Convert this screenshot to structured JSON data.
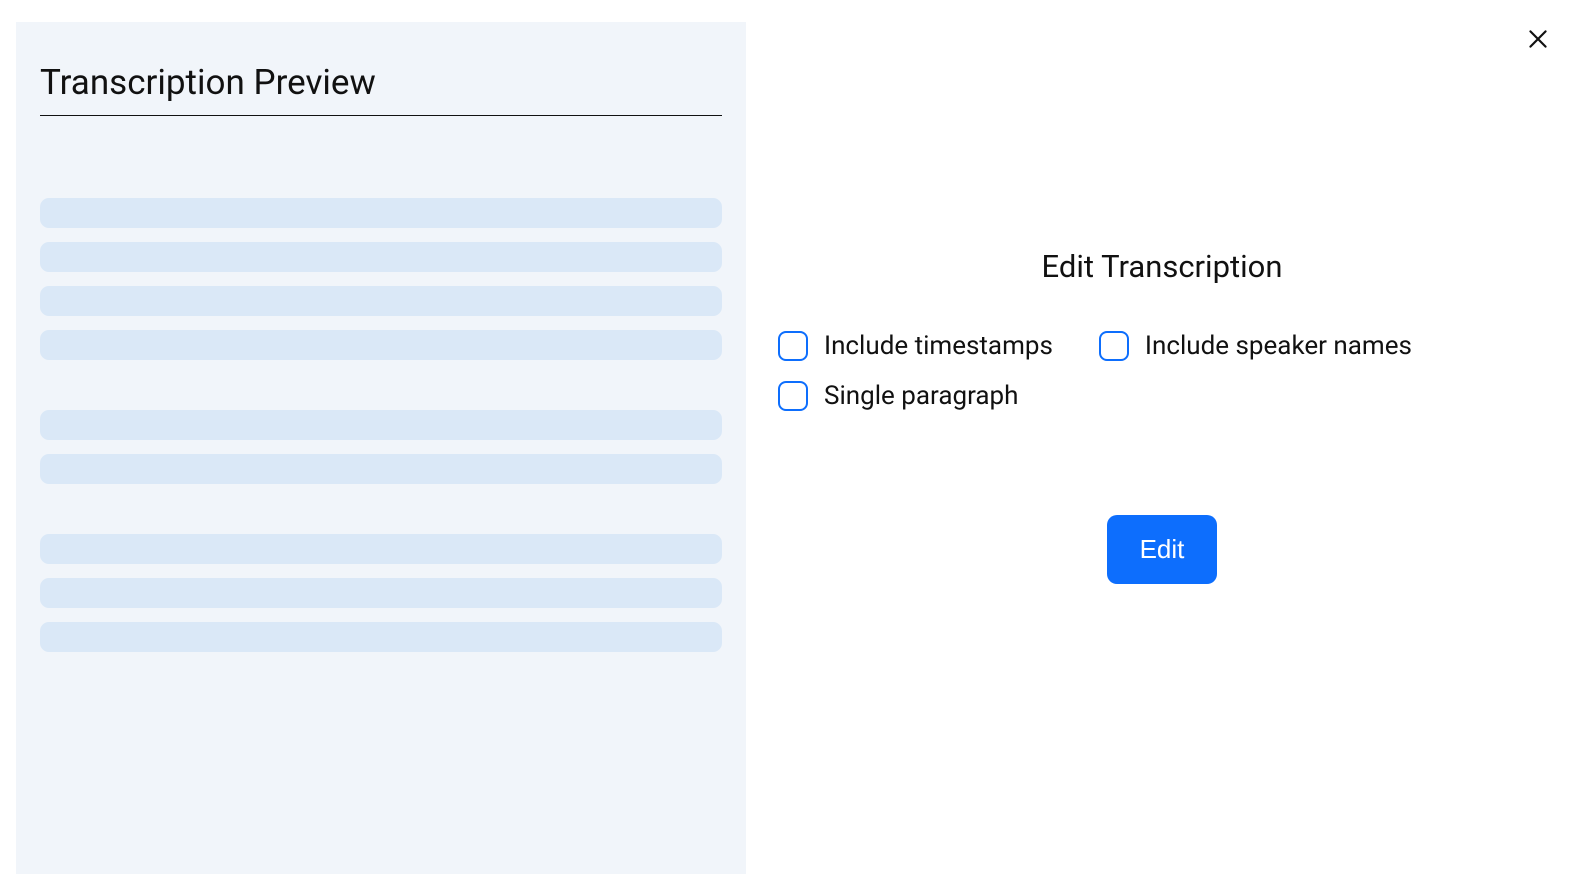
{
  "preview": {
    "title": "Transcription Preview"
  },
  "edit": {
    "title": "Edit Transcription",
    "options": [
      {
        "label": "Include timestamps",
        "checked": false
      },
      {
        "label": "Include speaker names",
        "checked": false
      },
      {
        "label": "Single paragraph",
        "checked": false
      }
    ],
    "button_label": "Edit"
  }
}
